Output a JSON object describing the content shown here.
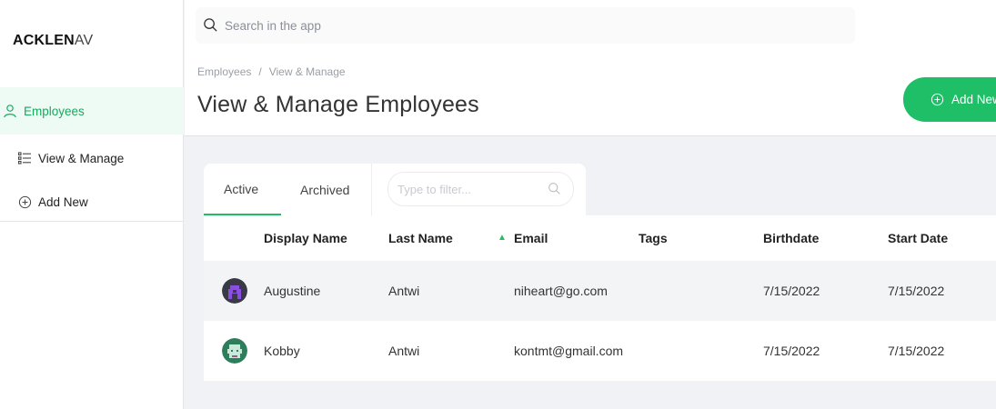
{
  "brand": {
    "bold": "ACKLEN",
    "thin": "AV"
  },
  "sidebar": {
    "items": [
      {
        "label": "Employees",
        "icon": "user-icon"
      },
      {
        "label": "View & Manage",
        "icon": "list-icon"
      },
      {
        "label": "Add New",
        "icon": "plus-circle-icon"
      }
    ]
  },
  "header": {
    "search_placeholder": "Search in the app",
    "breadcrumb": [
      "Employees",
      "View & Manage"
    ],
    "breadcrumb_sep": "/",
    "title": "View & Manage Employees",
    "add_button": "Add New"
  },
  "tabs": {
    "active": "Active",
    "archived": "Archived"
  },
  "filter": {
    "placeholder": "Type to filter..."
  },
  "table": {
    "columns": [
      "Display Name",
      "Last Name",
      "Email",
      "Tags",
      "Birthdate",
      "Start Date"
    ],
    "sort_column": "Email",
    "rows": [
      {
        "display_name": "Augustine",
        "last_name": "Antwi",
        "email": "niheart@go.com",
        "tags": "",
        "birthdate": "7/15/2022",
        "start_date": "7/15/2022"
      },
      {
        "display_name": "Kobby",
        "last_name": "Antwi",
        "email": "kontmt@gmail.com",
        "tags": "",
        "birthdate": "7/15/2022",
        "start_date": "7/15/2022"
      }
    ]
  },
  "colors": {
    "accent": "#1fbf68",
    "accent_text": "#1aa860",
    "active_bg": "#eefaf4",
    "row_alt": "#f3f4f6"
  }
}
